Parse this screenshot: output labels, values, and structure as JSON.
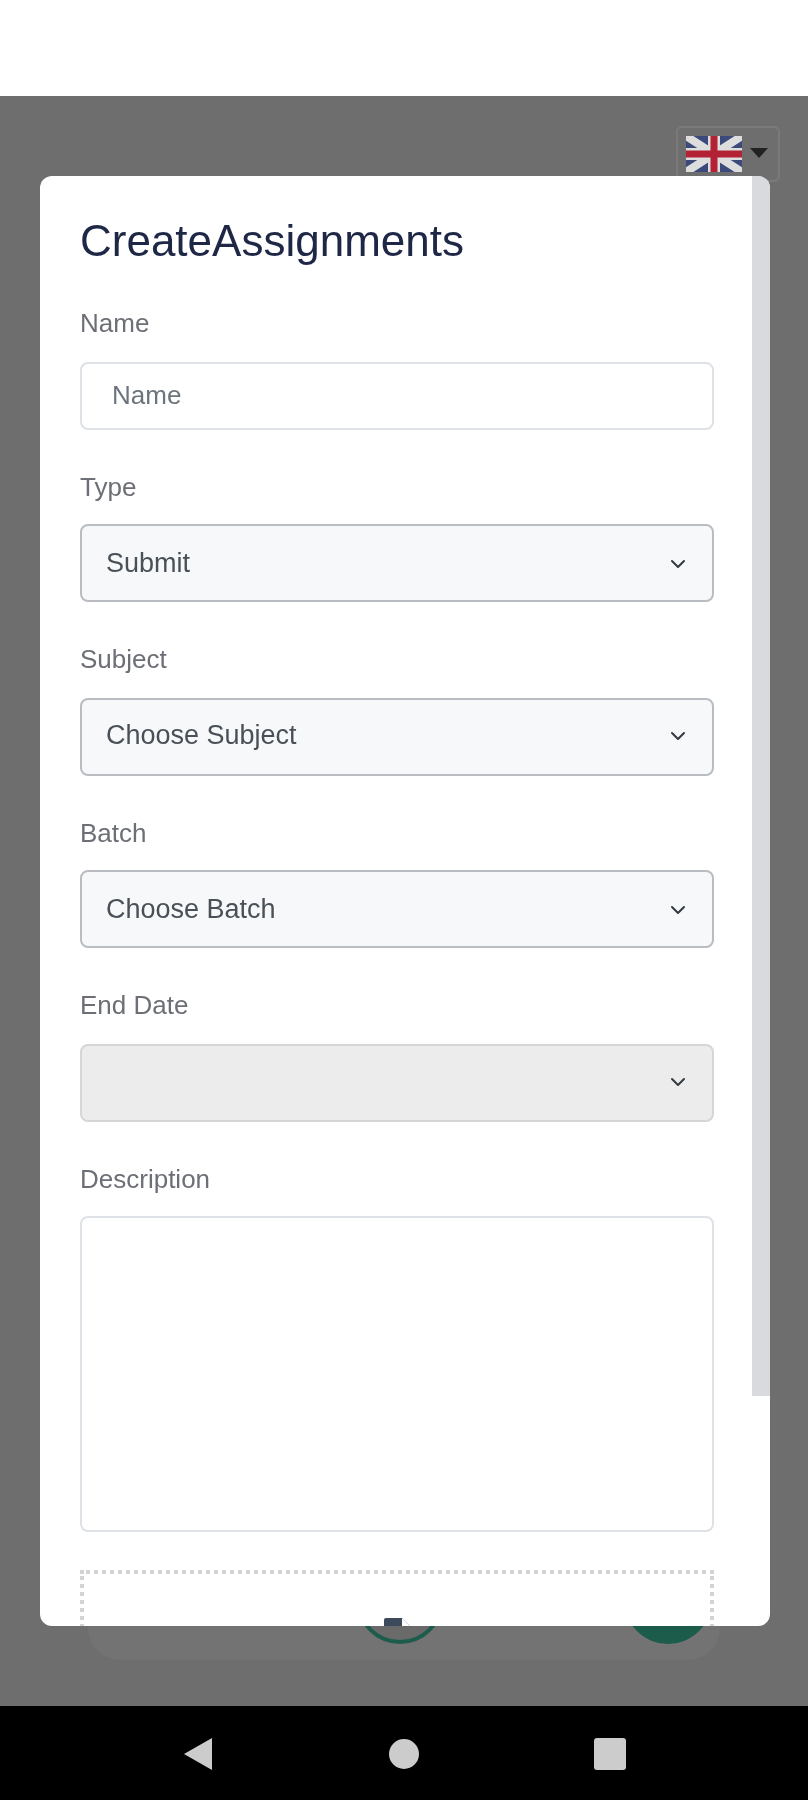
{
  "dialog": {
    "title": "CreateAssignments",
    "fields": [
      {
        "kind": "input",
        "label": "Name",
        "placeholder": "Name",
        "disabled": false
      },
      {
        "kind": "select",
        "label": "Type",
        "value": "Submit",
        "disabled": false
      },
      {
        "kind": "select",
        "label": "Subject",
        "value": "Choose Subject",
        "disabled": false
      },
      {
        "kind": "select",
        "label": "Batch",
        "value": "Choose Batch",
        "disabled": false
      },
      {
        "kind": "select",
        "label": "End Date",
        "disabled": true
      },
      {
        "kind": "textarea",
        "label": "Description",
        "disabled": false
      },
      {
        "kind": "file"
      }
    ]
  }
}
